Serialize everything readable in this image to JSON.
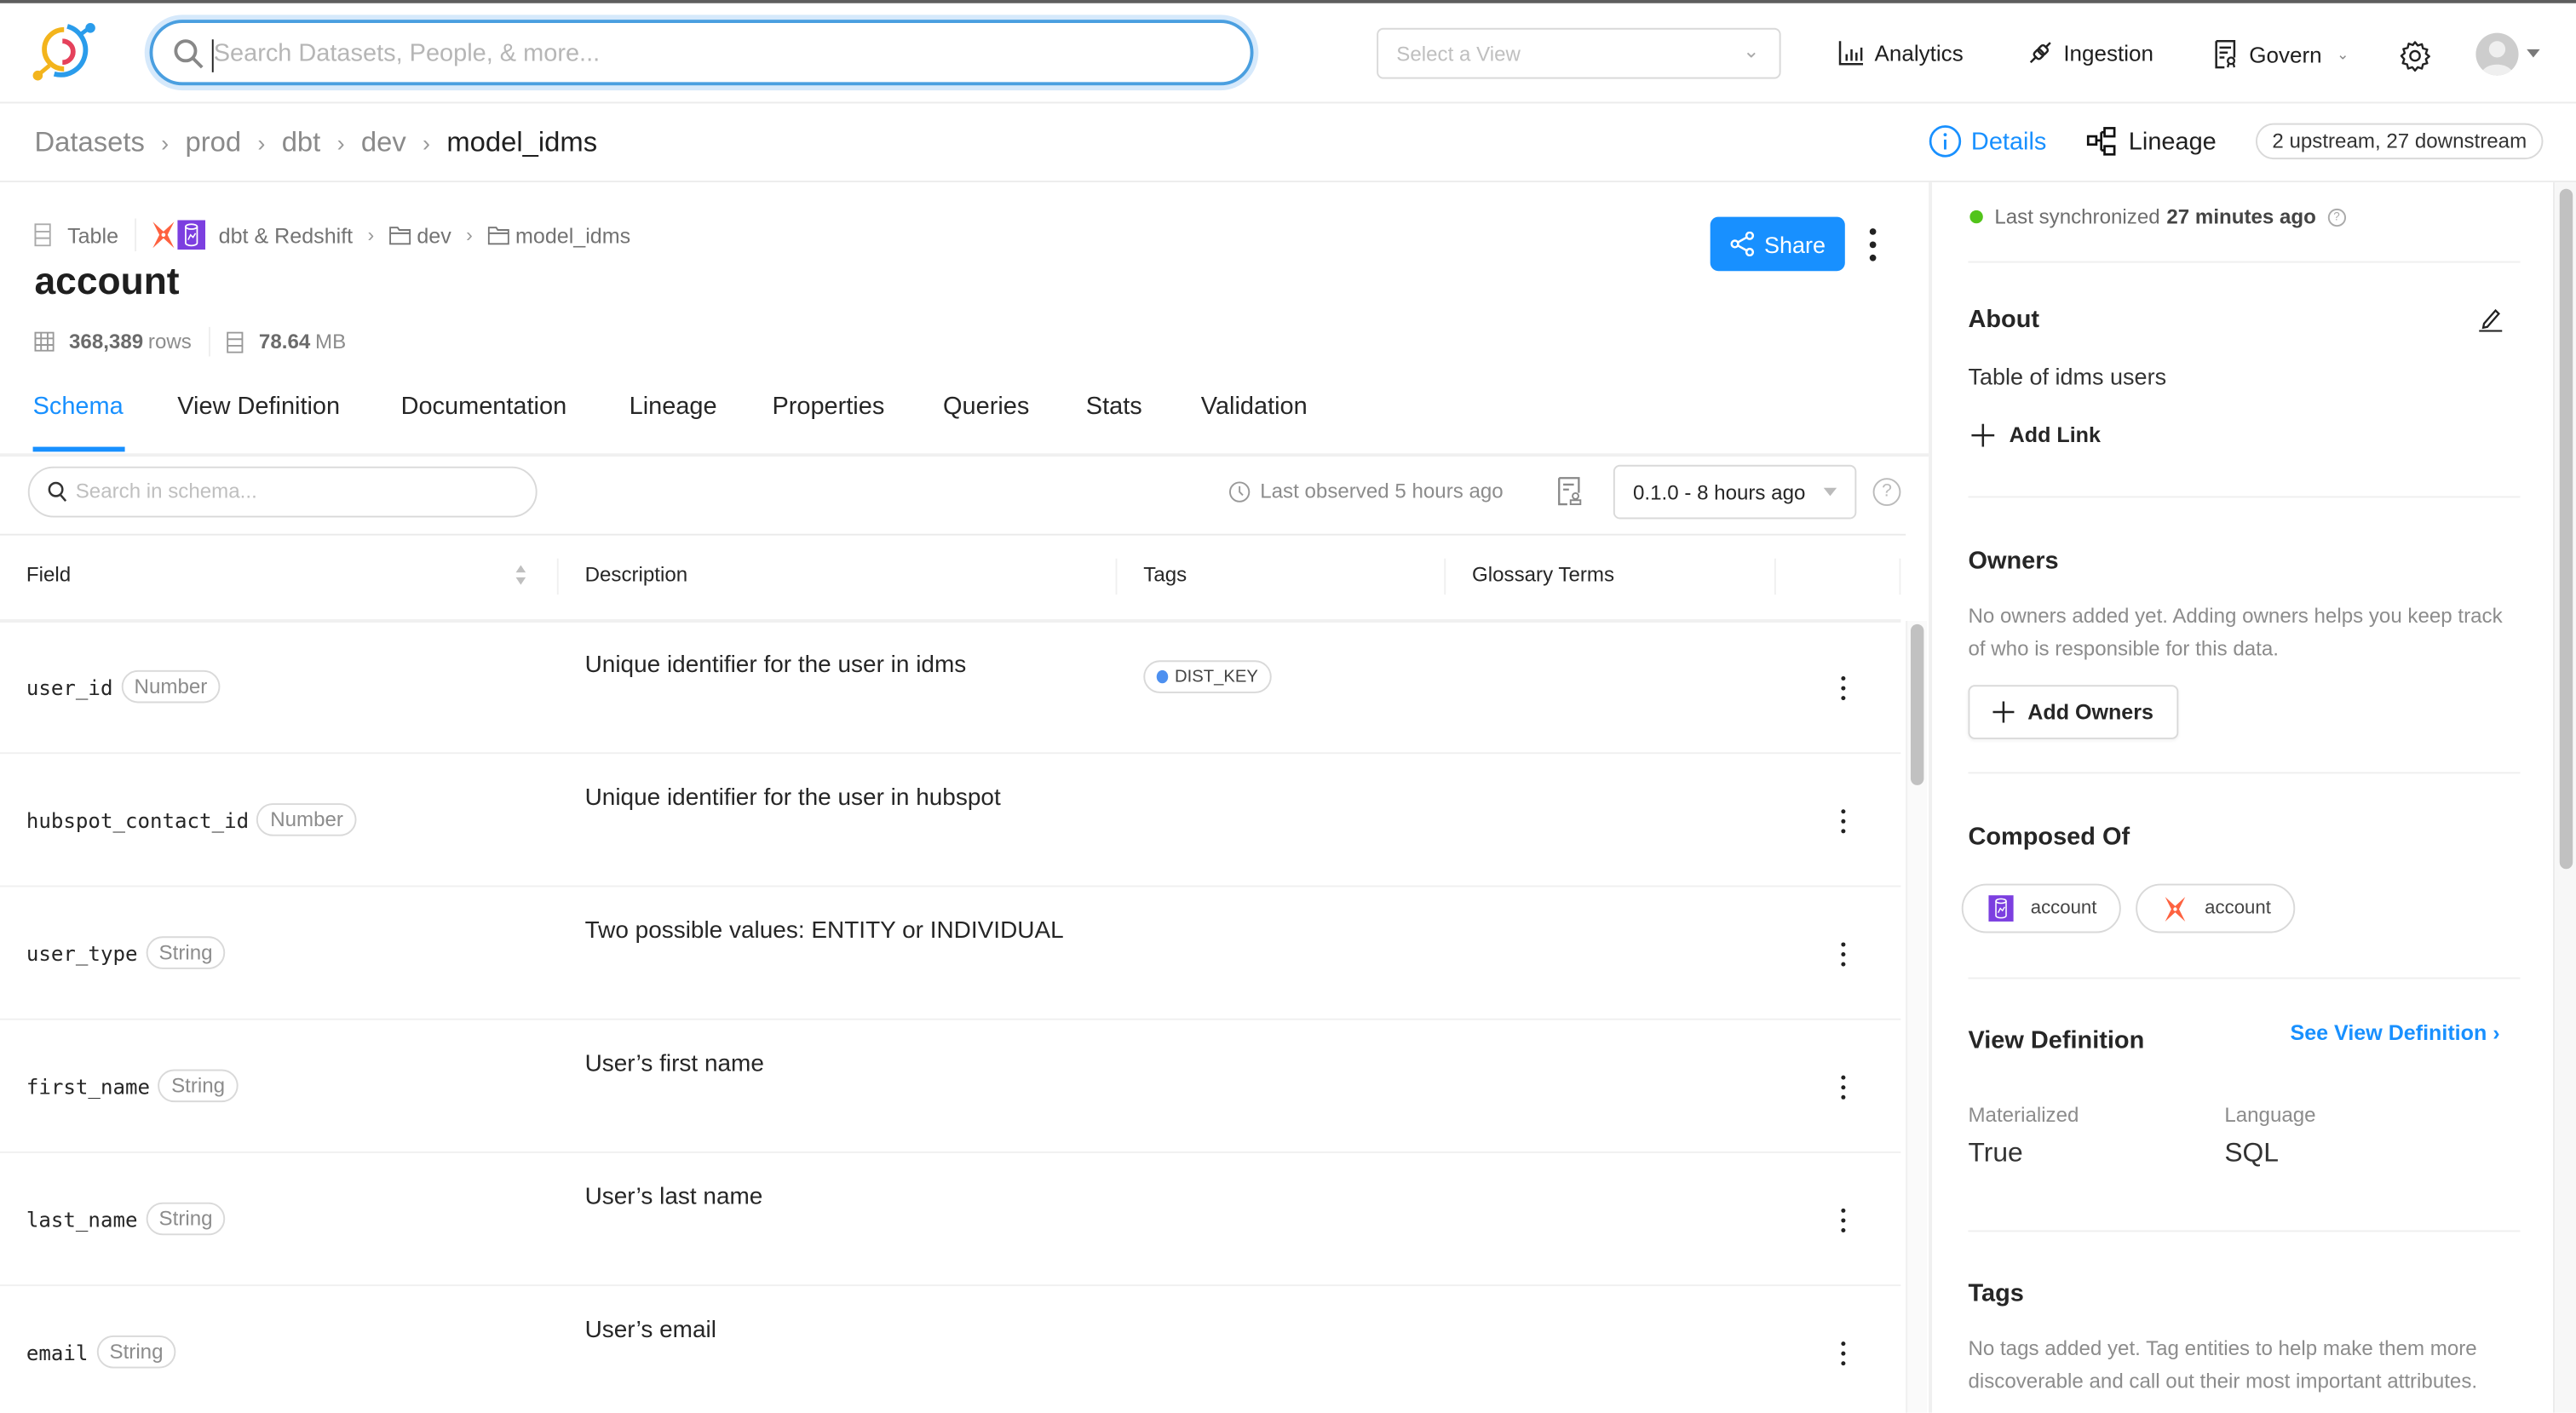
{
  "header": {
    "search_placeholder": "Search Datasets, People, & more...",
    "view_select_placeholder": "Select a View",
    "nav": [
      {
        "label": "Analytics",
        "icon": "bar-chart-icon"
      },
      {
        "label": "Ingestion",
        "icon": "plug-icon"
      },
      {
        "label": "Govern",
        "icon": "govern-icon",
        "has_dropdown": true
      }
    ]
  },
  "breadcrumb": {
    "items": [
      "Datasets",
      "prod",
      "dbt",
      "dev",
      "model_idms"
    ]
  },
  "entity_tabs": {
    "details": "Details",
    "lineage": "Lineage",
    "lineage_counts": "2 upstream, 27 downstream"
  },
  "entity": {
    "type": "Table",
    "platform": "dbt & Redshift",
    "containers": [
      "dev",
      "model_idms"
    ],
    "name": "account",
    "row_count": "368,389",
    "row_unit": "rows",
    "size": "78.64",
    "size_unit": "MB",
    "share_label": "Share"
  },
  "tabs": [
    "Schema",
    "View Definition",
    "Documentation",
    "Lineage",
    "Properties",
    "Queries",
    "Stats",
    "Validation"
  ],
  "active_tab": "Schema",
  "schema_toolbar": {
    "search_placeholder": "Search in schema...",
    "last_observed": "Last observed 5 hours ago",
    "version": "0.1.0 - 8 hours ago"
  },
  "schema_table": {
    "columns": [
      "Field",
      "Description",
      "Tags",
      "Glossary Terms"
    ],
    "rows": [
      {
        "field": "user_id",
        "type": "Number",
        "description": "Unique identifier for the user in idms",
        "tags": [
          "DIST_KEY"
        ]
      },
      {
        "field": "hubspot_contact_id",
        "type": "Number",
        "description": "Unique identifier for the user in hubspot",
        "tags": []
      },
      {
        "field": "user_type",
        "type": "String",
        "description": "Two possible values: ENTITY or INDIVIDUAL",
        "tags": []
      },
      {
        "field": "first_name",
        "type": "String",
        "description": "User’s first name",
        "tags": []
      },
      {
        "field": "last_name",
        "type": "String",
        "description": "User’s last name",
        "tags": []
      },
      {
        "field": "email",
        "type": "String",
        "description": "User’s email",
        "tags": []
      }
    ],
    "tag_color": "#4d90f0"
  },
  "sidebar": {
    "sync_prefix": "Last synchronized",
    "sync_time": "27 minutes ago",
    "about": {
      "title": "About",
      "text": "Table of idms users",
      "add_link": "Add Link"
    },
    "owners": {
      "title": "Owners",
      "empty": "No owners added yet. Adding owners helps you keep track of who is responsible for this data.",
      "add_label": "Add Owners"
    },
    "composed_of": {
      "title": "Composed Of",
      "items": [
        {
          "platform": "Redshift",
          "name": "account"
        },
        {
          "platform": "dbt",
          "name": "account"
        }
      ]
    },
    "view_definition": {
      "title": "View Definition",
      "link": "See View Definition",
      "materialized_label": "Materialized",
      "materialized_value": "True",
      "language_label": "Language",
      "language_value": "SQL"
    },
    "tags": {
      "title": "Tags",
      "empty": "No tags added yet. Tag entities to help make them more discoverable and call out their most important attributes."
    }
  },
  "colors": {
    "accent": "#1890ff",
    "sync_ok": "#52c41a",
    "dbt": "#fe6240",
    "redshift": "#7c3fe0"
  }
}
